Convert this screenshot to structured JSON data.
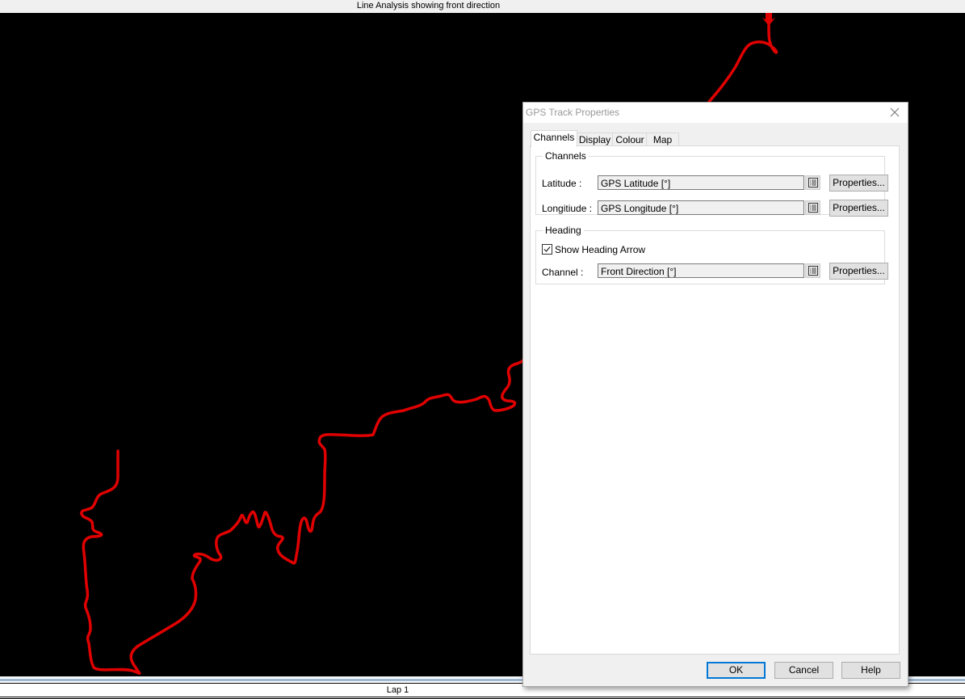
{
  "window": {
    "title": "Line Analysis showing front direction"
  },
  "track": {
    "color": "#e00000",
    "heading_arrow": "down-arrow-icon"
  },
  "footer": {
    "lap_label": "Lap 1"
  },
  "dialog": {
    "title": "GPS Track Properties",
    "close_icon": "close-icon",
    "tabs": [
      {
        "label": "Channels",
        "active": true
      },
      {
        "label": "Display",
        "active": false
      },
      {
        "label": "Colour",
        "active": false
      },
      {
        "label": "Map",
        "active": false
      }
    ],
    "channels_group": {
      "legend": "Channels",
      "latitude": {
        "label": "Latitude :",
        "value": "GPS Latitude [°]",
        "properties_label": "Properties..."
      },
      "longitude": {
        "label": "Longitiude :",
        "value": "GPS Longitude [°]",
        "properties_label": "Properties..."
      }
    },
    "heading_group": {
      "legend": "Heading",
      "show_heading_arrow": {
        "label": "Show Heading Arrow",
        "checked": true
      },
      "channel": {
        "label": "Channel :",
        "value": "Front Direction [°]",
        "properties_label": "Properties..."
      }
    },
    "buttons": {
      "ok": "OK",
      "cancel": "Cancel",
      "help": "Help"
    },
    "accent_color": "#0078d7"
  }
}
